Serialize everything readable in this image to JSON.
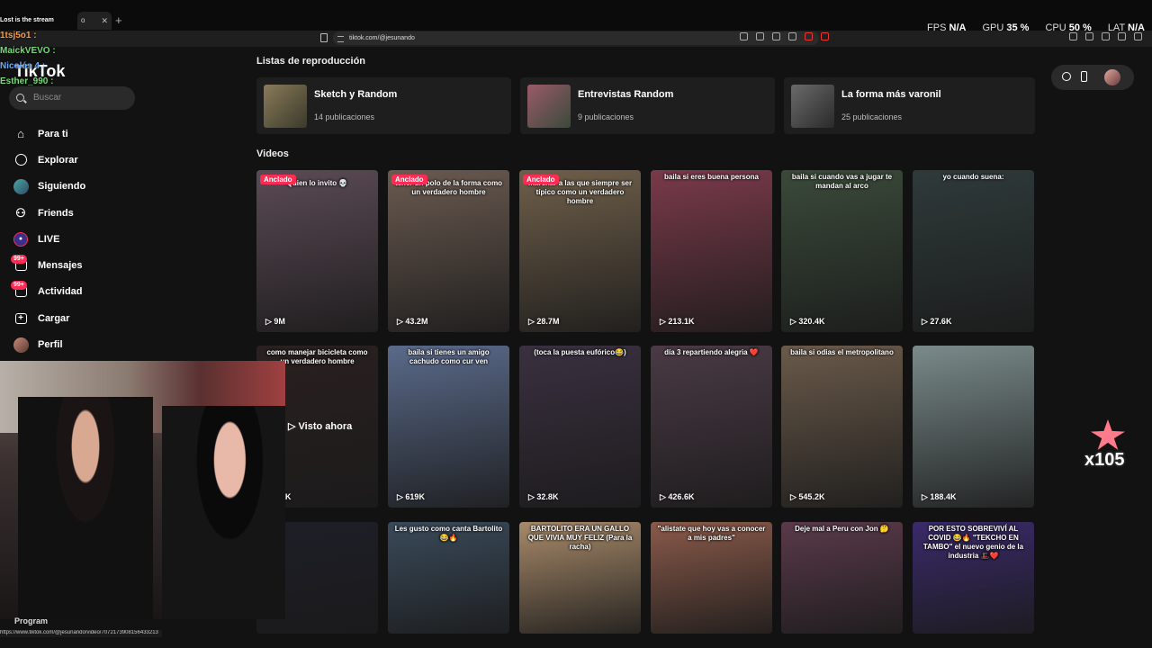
{
  "browser": {
    "tab_title": "o",
    "url": "tiktok.com/@jesunando",
    "stats": [
      {
        "label": "FPS",
        "value": "N/A"
      },
      {
        "label": "GPU",
        "value": "35 %"
      },
      {
        "label": "CPU",
        "value": "50 %"
      },
      {
        "label": "LAT",
        "value": "N/A"
      }
    ]
  },
  "sidebar": {
    "logo": "TikTok",
    "search_placeholder": "Buscar",
    "items": [
      {
        "label": "Para ti",
        "icon": "home-icon"
      },
      {
        "label": "Explorar",
        "icon": "compass-icon"
      },
      {
        "label": "Siguiendo",
        "icon": "following-avatar-icon"
      },
      {
        "label": "Friends",
        "icon": "friends-icon"
      },
      {
        "label": "LIVE",
        "icon": "live-icon"
      },
      {
        "label": "Mensajes",
        "icon": "messages-icon",
        "badge": "99+"
      },
      {
        "label": "Actividad",
        "icon": "activity-icon",
        "badge": "99+"
      },
      {
        "label": "Cargar",
        "icon": "upload-icon"
      },
      {
        "label": "Perfil",
        "icon": "profile-avatar-icon"
      }
    ]
  },
  "playlists": {
    "heading": "Listas de reproducción",
    "items": [
      {
        "title": "Sketch y Random",
        "count": "14 publicaciones"
      },
      {
        "title": "Entrevistas Random",
        "count": "9 publicaciones"
      },
      {
        "title": "La forma más varonil",
        "count": "25 publicaciones"
      }
    ]
  },
  "videos": {
    "heading": "Videos",
    "pinned_label": "Anclado",
    "watched_label": "▷ Visto ahora",
    "items": [
      {
        "caption": "Quien lo invito 💀",
        "views": "9M",
        "pinned": true,
        "color": "#5b4a55"
      },
      {
        "caption": "tener un polo de la forma como un verdadero hombre",
        "views": "43.2M",
        "pinned": true,
        "color": "#6a5a50"
      },
      {
        "caption": "marchar a las que siempre ser típico como un verdadero hombre",
        "views": "28.7M",
        "pinned": true,
        "color": "#6f5f4a"
      },
      {
        "caption": "baila si eres buena persona",
        "views": "213.1K",
        "pinned": false,
        "color": "#7a3a4a"
      },
      {
        "caption": "baila si cuando vas a jugar te mandan al arco",
        "views": "320.4K",
        "pinned": false,
        "color": "#3a4a3a"
      },
      {
        "caption": "yo cuando suena:",
        "views": "27.6K",
        "pinned": false,
        "color": "#2f3a3a"
      },
      {
        "caption": "como manejar bicicleta como un verdadero hombre",
        "views": "0.4K",
        "pinned": false,
        "color": "#2a2020"
      },
      {
        "caption": "baila si tienes un amigo cachudo como cur ven",
        "views": "619K",
        "pinned": false,
        "color": "#5a6a8a"
      },
      {
        "caption": "(toca la puesta eufórico😂)",
        "views": "32.8K",
        "pinned": false,
        "color": "#3a3040"
      },
      {
        "caption": "día 3 repartiendo alegria ❤️",
        "views": "426.6K",
        "pinned": false,
        "color": "#4a3a45"
      },
      {
        "caption": "baila si odias el metropolitano",
        "views": "545.2K",
        "pinned": false,
        "color": "#6a5a4a"
      },
      {
        "caption": "",
        "views": "188.4K",
        "pinned": false,
        "color": "#7a8a8a"
      },
      {
        "caption": "",
        "views": "",
        "pinned": false,
        "color": "#1e1e28"
      },
      {
        "caption": "Les gusto como canta Bartolito😂🔥",
        "views": "",
        "pinned": false,
        "color": "#3a4a5a"
      },
      {
        "caption": "BARTOLITO ERA UN GALLO QUE VIVIA MUY FELIZ (Para la racha)",
        "views": "",
        "pinned": false,
        "color": "#a88a6a"
      },
      {
        "caption": "\"alistate que hoy vas a conocer a mis padres\"",
        "views": "",
        "pinned": false,
        "color": "#8a5a4a"
      },
      {
        "caption": "Deje mal a Peru con Jon 🤔",
        "views": "",
        "pinned": false,
        "color": "#5a3a4a"
      },
      {
        "caption": "POR ESTO SOBREVIVÍ AL COVID 😂🔥 \"TEKCHO EN TAMBO\" el nuevo genio de la industria 🎩❤️",
        "views": "",
        "pinned": false,
        "color": "#3a2a6a"
      }
    ]
  },
  "overlay": {
    "chat": [
      {
        "user": "Lost is the stream",
        "color": "#ffffff"
      },
      {
        "user": "1tsj5o1 :",
        "color": "#ff9a3a"
      },
      {
        "user": "MaickVEVO :",
        "color": "#7ad87a"
      },
      {
        "user": "Nicolás 4 :",
        "color": "#66aaff"
      },
      {
        "user": "Esther_990 :",
        "color": "#7ad87a"
      }
    ],
    "program_label": "Program",
    "status_url": "https://www.tiktok.com/@jesunando/video/7072173908156433213",
    "counter": "x105"
  }
}
